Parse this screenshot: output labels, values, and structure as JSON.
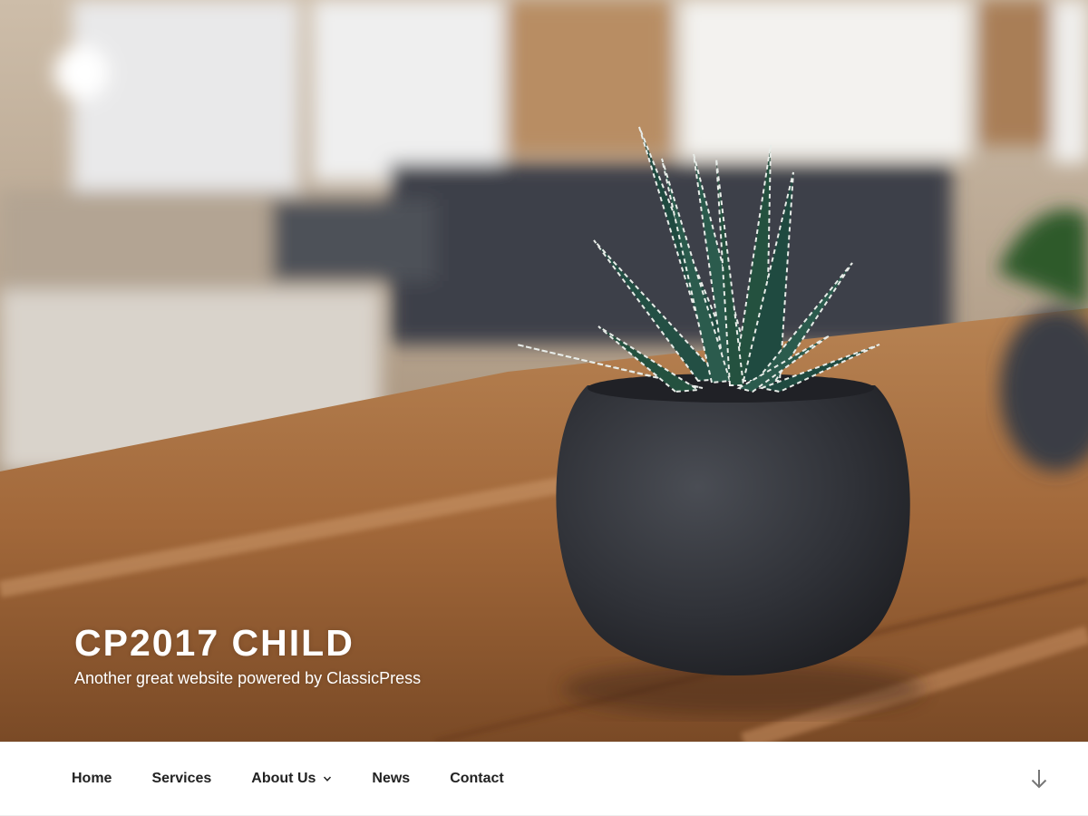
{
  "site": {
    "title": "CP2017 CHILD",
    "description": "Another great website powered by ClassicPress"
  },
  "header_image": {
    "subject": "succulent-plant-in-dark-round-pot-on-wooden-table"
  },
  "nav": {
    "items": [
      {
        "label": "Home",
        "has_submenu": false
      },
      {
        "label": "Services",
        "has_submenu": false
      },
      {
        "label": "About Us",
        "has_submenu": true
      },
      {
        "label": "News",
        "has_submenu": false
      },
      {
        "label": "Contact",
        "has_submenu": false
      }
    ],
    "scroll_icon": "arrow-down-icon"
  },
  "colors": {
    "nav_text": "#222222",
    "title_text": "#ffffff",
    "icon_gray": "#767676"
  }
}
